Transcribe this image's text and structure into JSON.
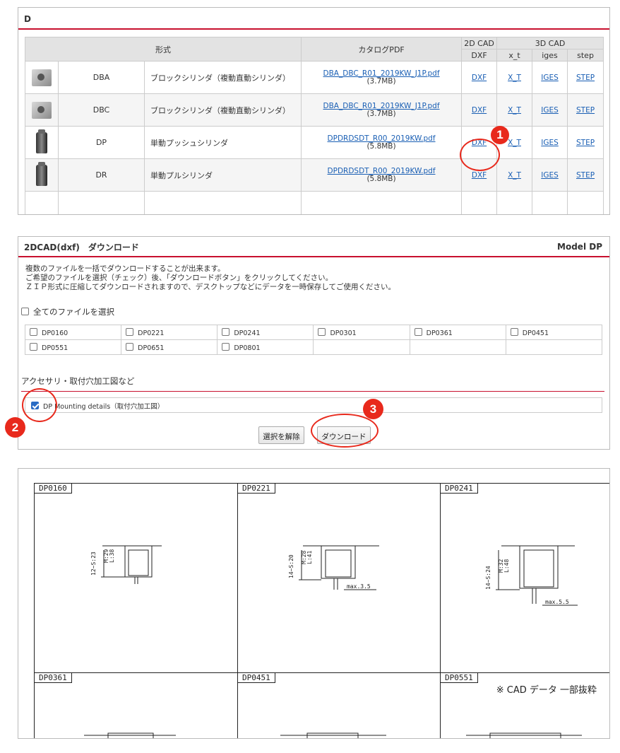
{
  "product_panel": {
    "title": "D",
    "headers": {
      "model": "形式",
      "catalog": "カタログPDF",
      "cad2d": "2D CAD",
      "cad3d": "3D CAD",
      "dxf": "DXF",
      "xt": "x_t",
      "iges": "iges",
      "step": "step"
    },
    "rows": [
      {
        "model": "DBA",
        "desc": "ブロックシリンダ（複動直動シリンダ）",
        "pdf": "DBA_DBC_R01_2019KW_J1P.pdf",
        "size": "(3.7MB)",
        "dxf": "DXF",
        "xt": "X_T",
        "iges": "IGES",
        "step": "STEP",
        "thumb": "block-cylinder-icon"
      },
      {
        "model": "DBC",
        "desc": "ブロックシリンダ（複動直動シリンダ）",
        "pdf": "DBA_DBC_R01_2019KW_J1P.pdf",
        "size": "(3.7MB)",
        "dxf": "DXF",
        "xt": "X_T",
        "iges": "IGES",
        "step": "STEP",
        "thumb": "block-cylinder-icon"
      },
      {
        "model": "DP",
        "desc": "単動プッシュシリンダ",
        "pdf": "DPDRDSDT_R00_2019KW.pdf",
        "size": "(5.8MB)",
        "dxf": "DXF",
        "xt": "X_T",
        "iges": "IGES",
        "step": "STEP",
        "thumb": "push-cylinder-icon"
      },
      {
        "model": "DR",
        "desc": "単動プルシリンダ",
        "pdf": "DPDRDSDT_R00_2019KW.pdf",
        "size": "(5.8MB)",
        "dxf": "DXF",
        "xt": "X_T",
        "iges": "IGES",
        "step": "STEP",
        "thumb": "pull-cylinder-icon"
      }
    ]
  },
  "markers": {
    "m1": "1",
    "m2": "2",
    "m3": "3"
  },
  "download_panel": {
    "title": "2DCAD(dxf)　ダウンロード",
    "model_label": "Model DP",
    "intro": [
      "複数のファイルを一括でダウンロードすることが出来ます。",
      "ご希望のファイルを選択（チェック）後、「ダウンロードボタン」をクリックしてください。",
      "ＺＩＰ形式に圧縮してダウンロードされますので、デスクトップなどにデータを一時保存してご使用ください。"
    ],
    "select_all": "全てのファイルを選択",
    "files": [
      "DP0160",
      "DP0221",
      "DP0241",
      "DP0301",
      "DP0361",
      "DP0451",
      "DP0551",
      "DP0651",
      "DP0801"
    ],
    "accessory_title": "アクセサリ・取付穴加工図など",
    "accessory_item": "DP Mounting details（取付穴加工図）",
    "clear_button": "選択を解除",
    "download_button": "ダウンロード"
  },
  "cad_preview": {
    "cells": [
      "DP0160",
      "DP0221",
      "DP0241",
      "DP0361",
      "DP0451",
      "DP0551"
    ],
    "dims": [
      {
        "s": "12~S:23",
        "m": "M:29",
        "l": "L:38",
        "max": ""
      },
      {
        "s": "14~S:20",
        "m": "M:28",
        "l": "L:41",
        "max": "max.3.5"
      },
      {
        "s": "14~S:24",
        "m": "M:32",
        "l": "L:48",
        "max": "max.5.5"
      }
    ],
    "note": "※ CAD データ 一部抜粋"
  }
}
